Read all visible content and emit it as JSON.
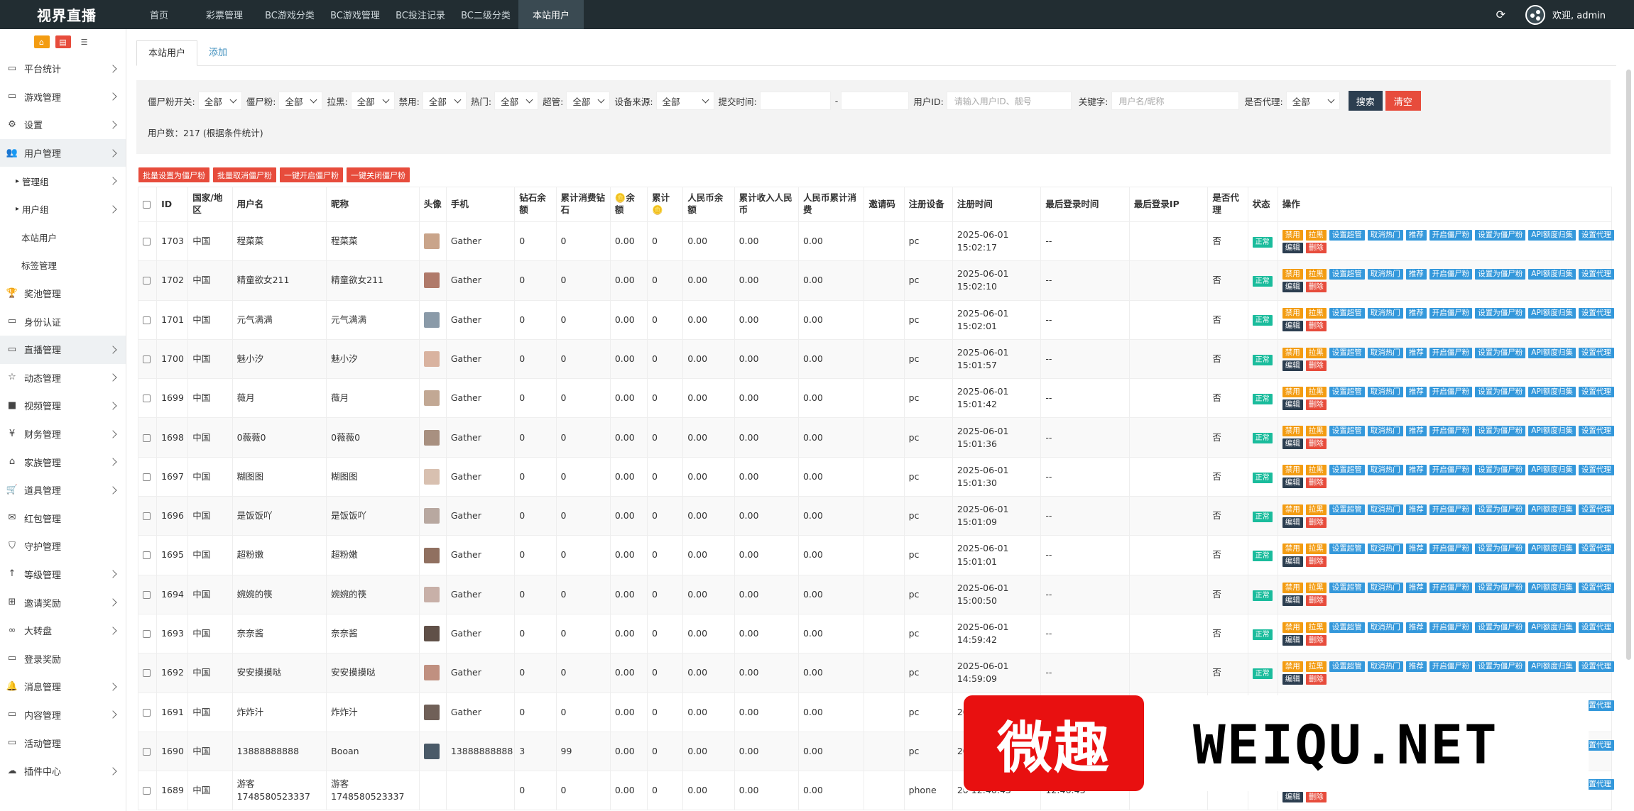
{
  "app": {
    "brand": "视界直播",
    "refresh_icon": "refresh-icon",
    "welcome": "欢迎, admin"
  },
  "topnav": [
    {
      "label": "首页",
      "active": false
    },
    {
      "label": "彩票管理",
      "active": false
    },
    {
      "label": "BC游戏分类",
      "active": false
    },
    {
      "label": "BC游戏管理",
      "active": false
    },
    {
      "label": "BC投注记录",
      "active": false
    },
    {
      "label": "BC二级分类",
      "active": false
    },
    {
      "label": "本站用户",
      "active": true
    }
  ],
  "sidebar": {
    "items": [
      {
        "label": "平台统计",
        "icon": "monitor-icon",
        "arrow": true
      },
      {
        "label": "游戏管理",
        "icon": "monitor-icon",
        "arrow": true
      },
      {
        "label": "设置",
        "icon": "gears-icon",
        "arrow": true
      },
      {
        "label": "用户管理",
        "icon": "users-icon",
        "arrow": true,
        "active": true
      },
      {
        "label": "管理组",
        "sub": true,
        "arrow": true
      },
      {
        "label": "用户组",
        "sub": true,
        "arrow": true
      },
      {
        "label": "本站用户",
        "sub2": true
      },
      {
        "label": "标签管理",
        "sub2": true
      },
      {
        "label": "奖池管理",
        "icon": "trophy-icon"
      },
      {
        "label": "身份认证",
        "icon": "monitor-icon"
      },
      {
        "label": "直播管理",
        "icon": "monitor-icon",
        "arrow": true,
        "active": true
      },
      {
        "label": "动态管理",
        "icon": "star-icon",
        "arrow": true
      },
      {
        "label": "视频管理",
        "icon": "video-icon",
        "arrow": true
      },
      {
        "label": "财务管理",
        "icon": "yen-icon",
        "arrow": true
      },
      {
        "label": "家族管理",
        "icon": "bank-icon",
        "arrow": true
      },
      {
        "label": "道具管理",
        "icon": "cart-icon",
        "arrow": true
      },
      {
        "label": "红包管理",
        "icon": "envelope-icon"
      },
      {
        "label": "守护管理",
        "icon": "shield-icon"
      },
      {
        "label": "等级管理",
        "icon": "level-icon",
        "arrow": true
      },
      {
        "label": "邀请奖励",
        "icon": "sitemap-icon",
        "arrow": true
      },
      {
        "label": "大转盘",
        "icon": "glasses-icon",
        "arrow": true
      },
      {
        "label": "登录奖励",
        "icon": "monitor-icon"
      },
      {
        "label": "消息管理",
        "icon": "bell-icon",
        "arrow": true
      },
      {
        "label": "内容管理",
        "icon": "monitor-icon",
        "arrow": true
      },
      {
        "label": "活动管理",
        "icon": "monitor-icon"
      },
      {
        "label": "插件中心",
        "icon": "cloud-icon",
        "arrow": true
      }
    ]
  },
  "tabs": [
    "本站用户",
    "添加"
  ],
  "filter": {
    "fields": [
      {
        "label": "僵尸粉开关:",
        "value": "全部",
        "w": 62
      },
      {
        "label": "僵尸粉:",
        "value": "全部",
        "w": 62
      },
      {
        "label": "拉黑:",
        "value": "全部",
        "w": 62
      },
      {
        "label": "禁用:",
        "value": "全部",
        "w": 62
      },
      {
        "label": "热门:",
        "value": "全部",
        "w": 62
      },
      {
        "label": "超管:",
        "value": "全部",
        "w": 62
      },
      {
        "label": "设备来源:",
        "value": "全部",
        "w": 82
      }
    ],
    "submit_time_label": "提交时间:",
    "dash": "-",
    "userid_label": "用户ID:",
    "userid_placeholder": "请输入用户ID、靓号",
    "keyword_label": "关键字:",
    "keyword_placeholder": "用户名/昵称",
    "agent_label": "是否代理:",
    "agent_value": "全部",
    "search_button": "搜索",
    "clear_button": "清空",
    "count": "用户数：217 (根据条件统计)"
  },
  "batch_buttons": [
    "批量设置为僵尸粉",
    "批量取消僵尸粉",
    "一键开启僵尸粉",
    "一键关闭僵尸粉"
  ],
  "table": {
    "headers": [
      "",
      "ID",
      "国家/地区",
      "用户名",
      "昵称",
      "头像",
      "手机",
      "钻石余额",
      "累计消费钻石",
      "🪙余额",
      "累计🪙",
      "人民币余额",
      "累计收入人民币",
      "人民币累计消费",
      "邀请码",
      "注册设备",
      "注册时间",
      "最后登录时间",
      "最后登录IP",
      "是否代理",
      "状态",
      "操作"
    ],
    "op_buttons": [
      {
        "label": "禁用",
        "c": "og"
      },
      {
        "label": "拉黑",
        "c": "og"
      },
      {
        "label": "设置超管",
        "c": "bl"
      },
      {
        "label": "取消热门",
        "c": "bl"
      },
      {
        "label": "推荐",
        "c": "bl"
      },
      {
        "label": "开启僵尸粉",
        "c": "bl"
      },
      {
        "label": "设置为僵尸粉",
        "c": "bl"
      },
      {
        "label": "API额度归集",
        "c": "bl"
      },
      {
        "label": "设置代理",
        "c": "bl"
      },
      {
        "label": "编辑",
        "c": "dk"
      },
      {
        "label": "删除",
        "c": "rd"
      }
    ],
    "rows": [
      {
        "id": "1703",
        "region": "中国",
        "username": "程菜菜",
        "nickname": "程菜菜",
        "avatar": "#c9a48a",
        "phone": "Gather",
        "d1": "0",
        "d2": "0",
        "c1": "0.00",
        "c2": "0",
        "r1": "0.00",
        "r2": "0.00",
        "r3": "0.00",
        "invite": "",
        "device": "pc",
        "reg": "2025-06-01 15:02:17",
        "last": "--",
        "ip": "",
        "agent": "否",
        "status": "正常"
      },
      {
        "id": "1702",
        "region": "中国",
        "username": "精童欲女211",
        "nickname": "精童欲女211",
        "avatar": "#b07a6a",
        "phone": "Gather",
        "d1": "0",
        "d2": "0",
        "c1": "0.00",
        "c2": "0",
        "r1": "0.00",
        "r2": "0.00",
        "r3": "0.00",
        "invite": "",
        "device": "pc",
        "reg": "2025-06-01 15:02:10",
        "last": "--",
        "ip": "",
        "agent": "否",
        "status": "正常"
      },
      {
        "id": "1701",
        "region": "中国",
        "username": "元气满满",
        "nickname": "元气满满",
        "avatar": "#8a9aa8",
        "phone": "Gather",
        "d1": "0",
        "d2": "0",
        "c1": "0.00",
        "c2": "0",
        "r1": "0.00",
        "r2": "0.00",
        "r3": "0.00",
        "invite": "",
        "device": "pc",
        "reg": "2025-06-01 15:02:01",
        "last": "--",
        "ip": "",
        "agent": "否",
        "status": "正常"
      },
      {
        "id": "1700",
        "region": "中国",
        "username": "魅小汐",
        "nickname": "魅小汐",
        "avatar": "#d9b3a0",
        "phone": "Gather",
        "d1": "0",
        "d2": "0",
        "c1": "0.00",
        "c2": "0",
        "r1": "0.00",
        "r2": "0.00",
        "r3": "0.00",
        "invite": "",
        "device": "pc",
        "reg": "2025-06-01 15:01:57",
        "last": "--",
        "ip": "",
        "agent": "否",
        "status": "正常"
      },
      {
        "id": "1699",
        "region": "中国",
        "username": "薇月",
        "nickname": "薇月",
        "avatar": "#c2a894",
        "phone": "Gather",
        "d1": "0",
        "d2": "0",
        "c1": "0.00",
        "c2": "0",
        "r1": "0.00",
        "r2": "0.00",
        "r3": "0.00",
        "invite": "",
        "device": "pc",
        "reg": "2025-06-01 15:01:42",
        "last": "--",
        "ip": "",
        "agent": "否",
        "status": "正常"
      },
      {
        "id": "1698",
        "region": "中国",
        "username": "0薇薇0",
        "nickname": "0薇薇0",
        "avatar": "#a89080",
        "phone": "Gather",
        "d1": "0",
        "d2": "0",
        "c1": "0.00",
        "c2": "0",
        "r1": "0.00",
        "r2": "0.00",
        "r3": "0.00",
        "invite": "",
        "device": "pc",
        "reg": "2025-06-01 15:01:36",
        "last": "--",
        "ip": "",
        "agent": "否",
        "status": "正常"
      },
      {
        "id": "1697",
        "region": "中国",
        "username": "糊图图",
        "nickname": "糊图图",
        "avatar": "#d8c0b0",
        "phone": "Gather",
        "d1": "0",
        "d2": "0",
        "c1": "0.00",
        "c2": "0",
        "r1": "0.00",
        "r2": "0.00",
        "r3": "0.00",
        "invite": "",
        "device": "pc",
        "reg": "2025-06-01 15:01:30",
        "last": "--",
        "ip": "",
        "agent": "否",
        "status": "正常"
      },
      {
        "id": "1696",
        "region": "中国",
        "username": "是饭饭吖",
        "nickname": "是饭饭吖",
        "avatar": "#b8a8a0",
        "phone": "Gather",
        "d1": "0",
        "d2": "0",
        "c1": "0.00",
        "c2": "0",
        "r1": "0.00",
        "r2": "0.00",
        "r3": "0.00",
        "invite": "",
        "device": "pc",
        "reg": "2025-06-01 15:01:09",
        "last": "--",
        "ip": "",
        "agent": "否",
        "status": "正常"
      },
      {
        "id": "1695",
        "region": "中国",
        "username": "超粉嫩",
        "nickname": "超粉嫩",
        "avatar": "#907060",
        "phone": "Gather",
        "d1": "0",
        "d2": "0",
        "c1": "0.00",
        "c2": "0",
        "r1": "0.00",
        "r2": "0.00",
        "r3": "0.00",
        "invite": "",
        "device": "pc",
        "reg": "2025-06-01 15:01:01",
        "last": "--",
        "ip": "",
        "agent": "否",
        "status": "正常"
      },
      {
        "id": "1694",
        "region": "中国",
        "username": "婉婉的筷",
        "nickname": "婉婉的筷",
        "avatar": "#c8b0a8",
        "phone": "Gather",
        "d1": "0",
        "d2": "0",
        "c1": "0.00",
        "c2": "0",
        "r1": "0.00",
        "r2": "0.00",
        "r3": "0.00",
        "invite": "",
        "device": "pc",
        "reg": "2025-06-01 15:00:50",
        "last": "--",
        "ip": "",
        "agent": "否",
        "status": "正常"
      },
      {
        "id": "1693",
        "region": "中国",
        "username": "奈奈酱",
        "nickname": "奈奈酱",
        "avatar": "#605048",
        "phone": "Gather",
        "d1": "0",
        "d2": "0",
        "c1": "0.00",
        "c2": "0",
        "r1": "0.00",
        "r2": "0.00",
        "r3": "0.00",
        "invite": "",
        "device": "pc",
        "reg": "2025-06-01 14:59:42",
        "last": "--",
        "ip": "",
        "agent": "否",
        "status": "正常"
      },
      {
        "id": "1692",
        "region": "中国",
        "username": "安安摸摸哒",
        "nickname": "安安摸摸哒",
        "avatar": "#c09080",
        "phone": "Gather",
        "d1": "0",
        "d2": "0",
        "c1": "0.00",
        "c2": "0",
        "r1": "0.00",
        "r2": "0.00",
        "r3": "0.00",
        "invite": "",
        "device": "pc",
        "reg": "2025-06-01 14:59:09",
        "last": "--",
        "ip": "",
        "agent": "否",
        "status": "正常"
      },
      {
        "id": "1691",
        "region": "中国",
        "username": "炸炸汁",
        "nickname": "炸炸汁",
        "avatar": "#706058",
        "phone": "Gather",
        "d1": "0",
        "d2": "0",
        "c1": "0.00",
        "c2": "0",
        "r1": "0.00",
        "r2": "0.00",
        "r3": "0.00",
        "invite": "",
        "device": "pc",
        "reg": "20 14",
        "last": "",
        "ip": "",
        "agent": "",
        "status": ""
      },
      {
        "id": "1690",
        "region": "中国",
        "username": "13888888888",
        "nickname": "Booan",
        "avatar": "#4a5a68",
        "phone": "13888888888",
        "d1": "3",
        "d2": "99",
        "c1": "0.00",
        "c2": "0",
        "r1": "0.00",
        "r2": "0.00",
        "r3": "0.00",
        "invite": "",
        "device": "pc",
        "reg": "20 14",
        "last": "",
        "ip": "",
        "agent": "",
        "status": ""
      },
      {
        "id": "1689",
        "region": "中国",
        "username": "游客 1748580523337",
        "nickname": "游客 1748580523337",
        "avatar": "",
        "phone": "",
        "d1": "0",
        "d2": "0",
        "c1": "0.00",
        "c2": "0",
        "r1": "0.00",
        "r2": "0.00",
        "r3": "0.00",
        "invite": "",
        "device": "phone",
        "reg": "20 12:46:43",
        "last": "12:46:43",
        "ip": "",
        "agent": "",
        "status": ""
      }
    ]
  },
  "watermark": {
    "left": "微趣",
    "right": "WEIQU.NET"
  }
}
